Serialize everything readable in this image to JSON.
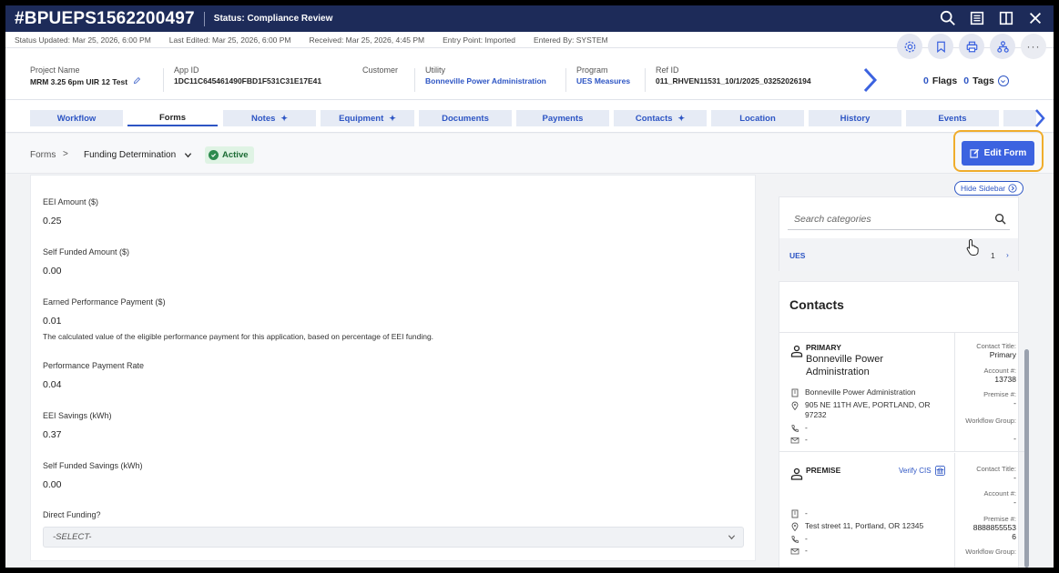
{
  "header": {
    "record_id": "#BPUEPS1562200497",
    "status": "Status: Compliance Review"
  },
  "meta": {
    "status_updated": "Status Updated: Mar 25, 2026, 6:00 PM",
    "last_edited": "Last Edited: Mar 25, 2026, 6:00 PM",
    "received": "Received: Mar 25, 2026, 4:45 PM",
    "entry_point": "Entry Point: Imported",
    "entered_by": "Entered By: SYSTEM"
  },
  "project": {
    "name_label": "Project Name",
    "name_value": "MRM 3.25 6pm UIR 12 Test",
    "app_id_label": "App ID",
    "app_id_value": "1DC11C645461490FBD1F531C31E17E41",
    "customer_label": "Customer",
    "utility_label": "Utility",
    "utility_value": "Bonneville Power Administration",
    "program_label": "Program",
    "program_value": "UES Measures",
    "ref_label": "Ref ID",
    "ref_value": "011_RHVEN11531_10/1/2025_03252026194",
    "flags_count": "0",
    "flags_label": "Flags",
    "tags_count": "0",
    "tags_label": "Tags"
  },
  "tabs": [
    {
      "label": "Workflow"
    },
    {
      "label": "Forms"
    },
    {
      "label": "Notes"
    },
    {
      "label": "Equipment"
    },
    {
      "label": "Documents"
    },
    {
      "label": "Payments"
    },
    {
      "label": "Contacts"
    },
    {
      "label": "Location"
    },
    {
      "label": "History"
    },
    {
      "label": "Events"
    }
  ],
  "breadcrumb": {
    "root": "Forms",
    "current": "Funding Determination",
    "status_badge": "Active"
  },
  "edit_form_label": "Edit Form",
  "form": {
    "fields": [
      {
        "label": "EEI Amount ($)",
        "value": "0.25"
      },
      {
        "label": "Self Funded Amount ($)",
        "value": "0.00"
      },
      {
        "label": "Earned Performance Payment ($)",
        "value": "0.01",
        "help": "The calculated value of the eligible performance payment for this application, based on percentage of EEI funding."
      },
      {
        "label": "Performance Payment Rate",
        "value": "0.04"
      },
      {
        "label": "EEI Savings (kWh)",
        "value": "0.37"
      },
      {
        "label": "Self Funded Savings (kWh)",
        "value": "0.00"
      }
    ],
    "direct_funding_label": "Direct Funding?",
    "direct_funding_value": "-SELECT-"
  },
  "sidebar": {
    "hide_label": "Hide Sidebar",
    "search_placeholder": "Search categories",
    "category": {
      "label": "UES",
      "count": "1"
    },
    "contacts_title": "Contacts",
    "contacts": [
      {
        "type": "PRIMARY",
        "name": "Bonneville Power Administration",
        "company": "Bonneville Power Administration",
        "address": "905 NE 11TH AVE, PORTLAND, OR 97232",
        "phone": "-",
        "email": "-",
        "contact_title_label": "Contact Title:",
        "contact_title": "Primary",
        "account_label": "Account #:",
        "account": "13738",
        "premise_label": "Premise #:",
        "premise": "-",
        "workflow_group_label": "Workflow Group:",
        "workflow_group": "-"
      },
      {
        "type": "PREMISE",
        "verify_label": "Verify CIS",
        "company": "-",
        "address": "Test street 11, Portland, OR 12345",
        "phone": "-",
        "email": "-",
        "contact_title_label": "Contact Title:",
        "contact_title": "-",
        "account_label": "Account #:",
        "account": "-",
        "premise_label": "Premise #:",
        "premise": "8888855553\n6",
        "workflow_group_label": "Workflow Group:",
        "workflow_group": "-"
      }
    ]
  },
  "colors": {
    "header_bg": "#1d2b59",
    "accent": "#2d55c4",
    "primary_button": "#3c63e0",
    "highlight_outline": "#f0ad2c",
    "active_badge_bg": "#dff3e4",
    "active_badge_text": "#1b6b34"
  }
}
